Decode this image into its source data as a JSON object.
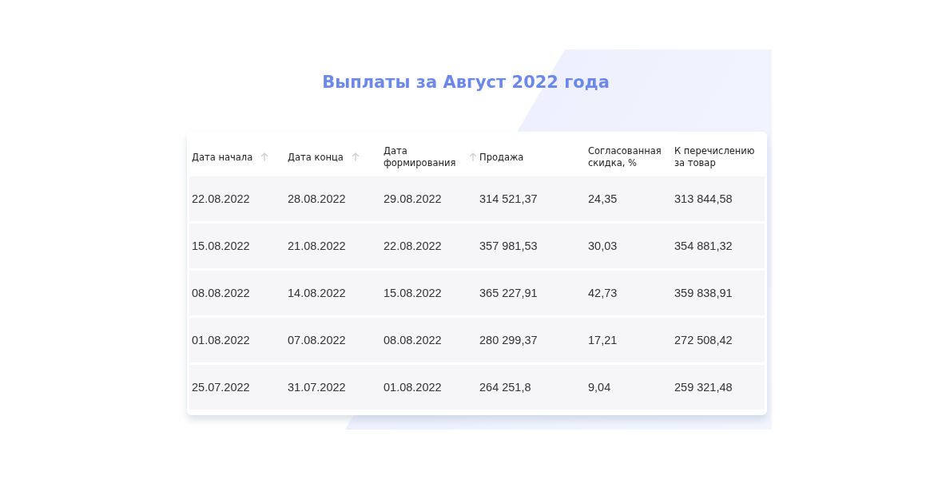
{
  "title": "Выплаты за Август 2022 года",
  "table": {
    "columns": [
      {
        "label": "Дата начала",
        "sortable": true
      },
      {
        "label": "Дата конца",
        "sortable": true
      },
      {
        "label": "Дата формирования",
        "sortable": true
      },
      {
        "label": "Продажа",
        "sortable": false
      },
      {
        "label": "Согласованная скидка, %",
        "sortable": false
      },
      {
        "label": "К перечислению за товар",
        "sortable": false
      }
    ],
    "rows": [
      [
        "22.08.2022",
        "28.08.2022",
        "29.08.2022",
        "314 521,37",
        "24,35",
        "313 844,58"
      ],
      [
        "15.08.2022",
        "21.08.2022",
        "22.08.2022",
        "357 981,53",
        "30,03",
        "354 881,32"
      ],
      [
        "08.08.2022",
        "14.08.2022",
        "15.08.2022",
        "365 227,91",
        "42,73",
        "359 838,91"
      ],
      [
        "01.08.2022",
        "07.08.2022",
        "08.08.2022",
        "280 299,37",
        "17,21",
        "272 508,42"
      ],
      [
        "25.07.2022",
        "31.07.2022",
        "01.08.2022",
        "264 251,8",
        "9,04",
        "259 321,48"
      ]
    ]
  }
}
